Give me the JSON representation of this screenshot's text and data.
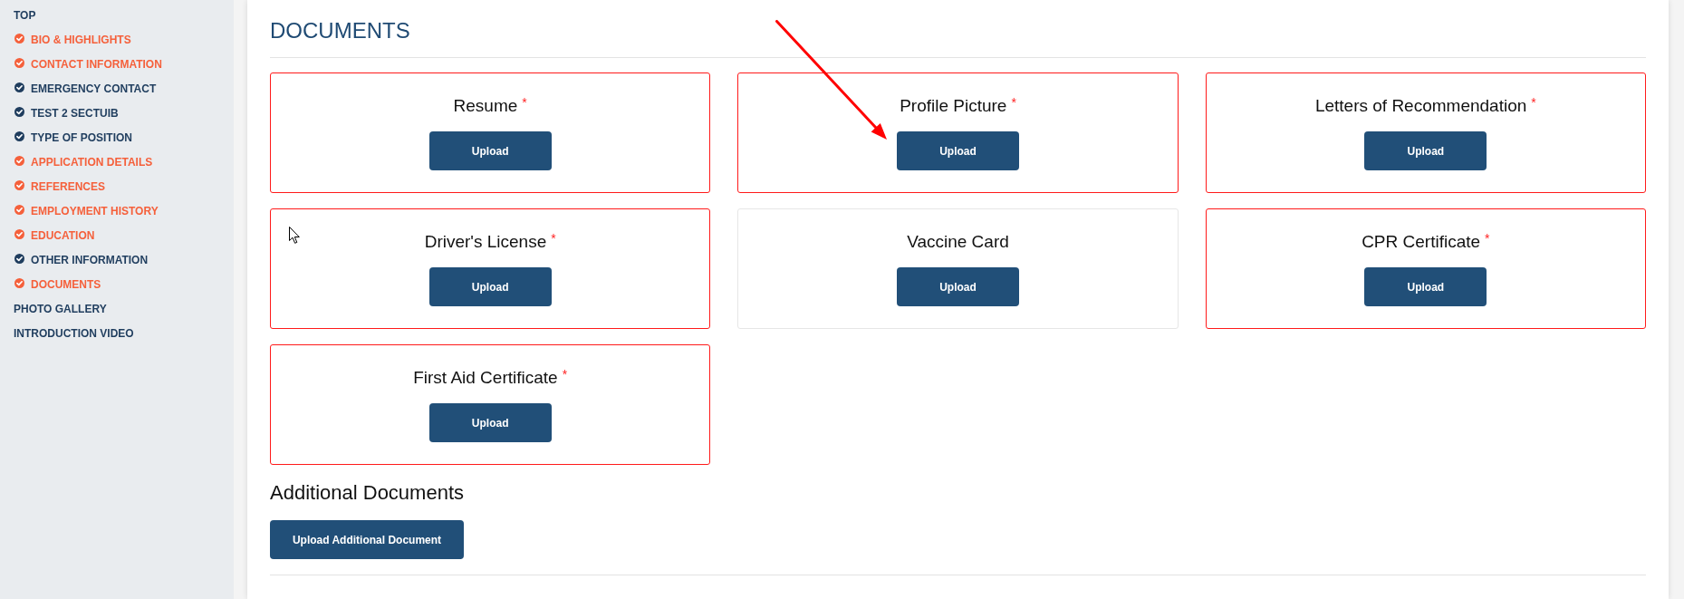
{
  "sidebar": {
    "items": [
      {
        "label": "TOP",
        "kind": "plain"
      },
      {
        "label": "BIO & HIGHLIGHTS",
        "kind": "checked",
        "color": "#f5603b"
      },
      {
        "label": "CONTACT INFORMATION",
        "kind": "checked",
        "color": "#f5603b"
      },
      {
        "label": "EMERGENCY CONTACT",
        "kind": "checked",
        "color": "#1f3d5e"
      },
      {
        "label": "TEST 2 SECTUIB",
        "kind": "checked",
        "color": "#1f3d5e"
      },
      {
        "label": "TYPE OF POSITION",
        "kind": "checked",
        "color": "#1f3d5e"
      },
      {
        "label": "APPLICATION DETAILS",
        "kind": "checked",
        "color": "#f5603b"
      },
      {
        "label": "REFERENCES",
        "kind": "checked",
        "color": "#f5603b"
      },
      {
        "label": "EMPLOYMENT HISTORY",
        "kind": "checked",
        "color": "#f5603b"
      },
      {
        "label": "EDUCATION",
        "kind": "checked",
        "color": "#f5603b"
      },
      {
        "label": "OTHER INFORMATION",
        "kind": "checked",
        "color": "#1f3d5e"
      },
      {
        "label": "DOCUMENTS",
        "kind": "checked",
        "color": "#f5603b"
      },
      {
        "label": "PHOTO GALLERY",
        "kind": "plain"
      },
      {
        "label": "INTRODUCTION VIDEO",
        "kind": "plain"
      }
    ]
  },
  "section": {
    "title": "DOCUMENTS"
  },
  "documents": [
    {
      "title": "Resume",
      "required": true,
      "asterisk": "*",
      "button": "Upload"
    },
    {
      "title": "Profile Picture",
      "required": true,
      "asterisk": "*",
      "button": "Upload"
    },
    {
      "title": "Letters of Recommendation",
      "required": true,
      "asterisk": "*",
      "button": "Upload"
    },
    {
      "title": "Driver's License",
      "required": true,
      "asterisk": "*",
      "button": "Upload"
    },
    {
      "title": "Vaccine Card",
      "required": false,
      "button": "Upload"
    },
    {
      "title": "CPR Certificate",
      "required": true,
      "asterisk": "*",
      "button": "Upload"
    },
    {
      "title": "First Aid Certificate",
      "required": true,
      "asterisk": "*",
      "button": "Upload"
    }
  ],
  "additional": {
    "title": "Additional Documents",
    "button": "Upload Additional Document"
  }
}
